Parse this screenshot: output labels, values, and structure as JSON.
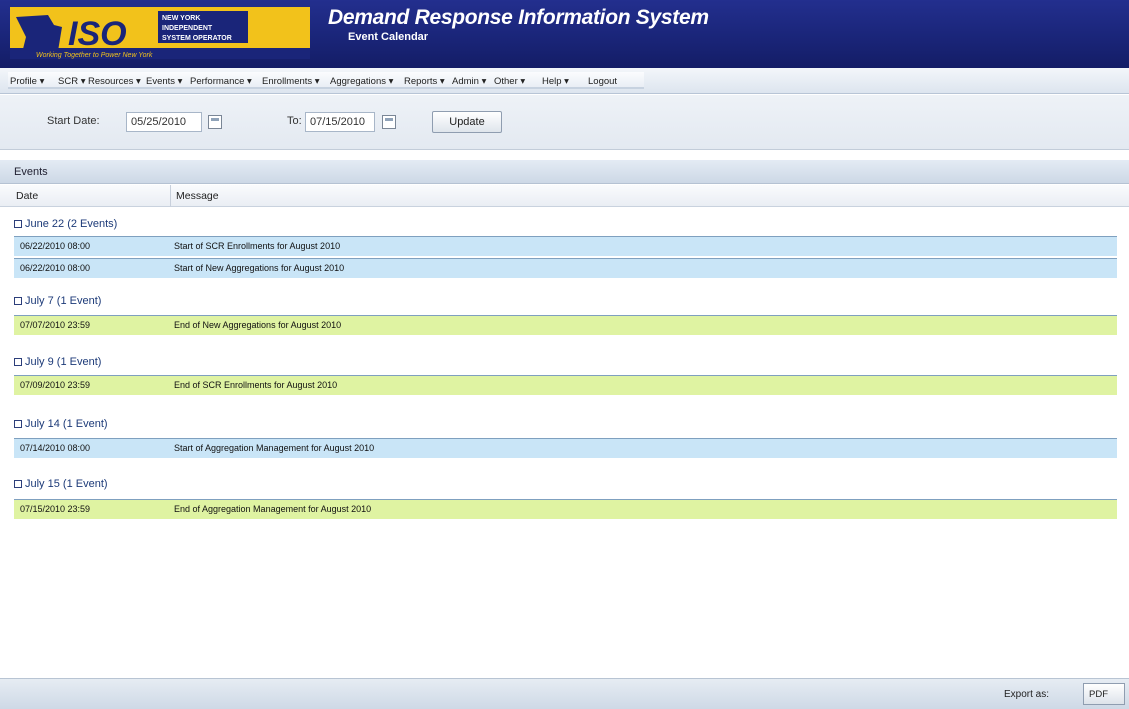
{
  "header": {
    "logo": {
      "wordmark": "ISO",
      "org_lines": [
        "NEW YORK",
        "INDEPENDENT",
        "SYSTEM OPERATOR"
      ],
      "tagline": "Working Together to Power New York"
    },
    "title": "Demand Response Information System",
    "subtitle": "Event Calendar"
  },
  "menu": {
    "items": [
      "Profile ▾",
      "SCR ▾",
      "Resources ▾",
      "Events ▾",
      "Performance ▾",
      "Enrollments ▾",
      "Aggregations ▾",
      "Reports ▾",
      "Admin ▾",
      "Other ▾",
      "Help ▾",
      "Logout"
    ]
  },
  "filter": {
    "start_label": "Start Date:",
    "start_value": "05/25/2010",
    "to_label": "To:",
    "to_value": "07/15/2010",
    "update_label": "Update"
  },
  "events": {
    "panel_title": "Events",
    "columns": [
      "Date",
      "Message"
    ],
    "groups": [
      {
        "label": "June 22 (2 Events)",
        "rows": [
          {
            "date": "06/22/2010 08:00",
            "message": "Start of SCR Enrollments for August 2010",
            "color": "blue"
          },
          {
            "date": "06/22/2010 08:00",
            "message": "Start of New Aggregations for August 2010",
            "color": "blue"
          }
        ]
      },
      {
        "label": "July 7 (1 Event)",
        "rows": [
          {
            "date": "07/07/2010 23:59",
            "message": "End of New Aggregations for August 2010",
            "color": "green"
          }
        ]
      },
      {
        "label": "July 9 (1 Event)",
        "rows": [
          {
            "date": "07/09/2010 23:59",
            "message": "End of SCR Enrollments for August 2010",
            "color": "green"
          }
        ]
      },
      {
        "label": "July 14 (1 Event)",
        "rows": [
          {
            "date": "07/14/2010 08:00",
            "message": "Start of Aggregation Management for August 2010",
            "color": "blue"
          }
        ]
      },
      {
        "label": "July 15 (1 Event)",
        "rows": [
          {
            "date": "07/15/2010 23:59",
            "message": "End of Aggregation Management for August 2010",
            "color": "green"
          }
        ]
      }
    ]
  },
  "footer": {
    "export_label": "Export as:",
    "export_button": "PDF"
  },
  "colors": {
    "header_bg": "#1a2579",
    "row_blue": "#c9e5f7",
    "row_green": "#dff3a2",
    "logo_yellow": "#f2c21b"
  }
}
